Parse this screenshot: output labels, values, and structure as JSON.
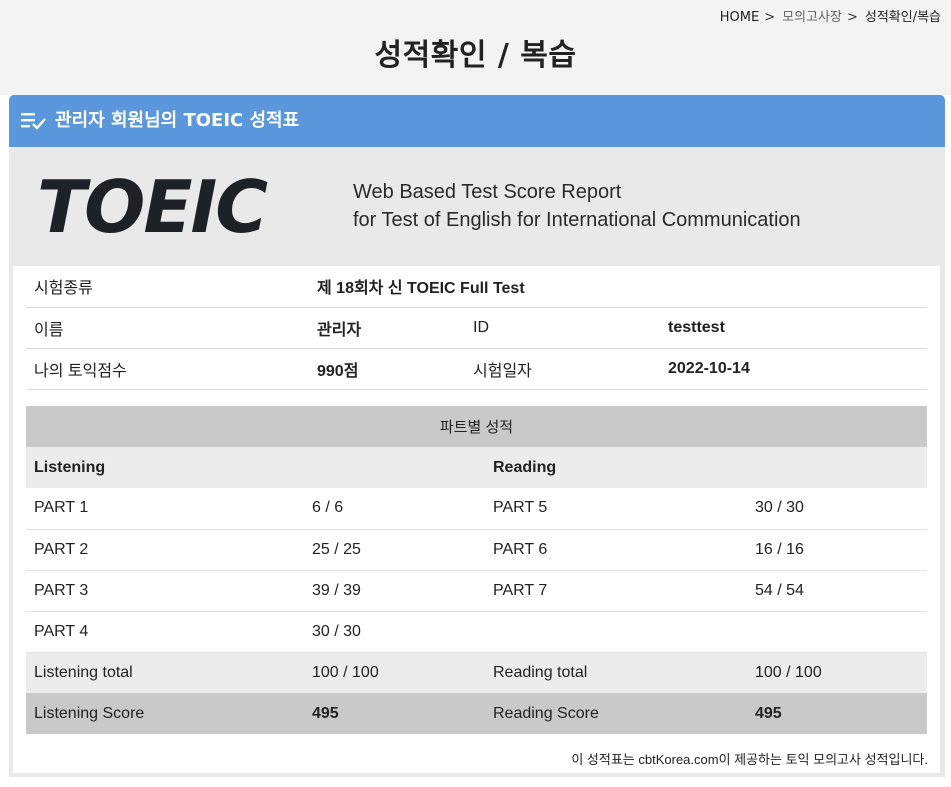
{
  "breadcrumb": {
    "home": "HOME",
    "section": "모의고사장",
    "current": "성적확인/복습",
    "separator": ">"
  },
  "page_title": "성적확인 / 복습",
  "panel": {
    "title": "관리자 회원님의 TOEIC 성적표",
    "icon": "list-check-icon",
    "header_color": "#5a97dd"
  },
  "report": {
    "logo_text": "TOEIC",
    "subtitle_line1": "Web Based Test Score Report",
    "subtitle_line2": "for Test of English for International Communication"
  },
  "info": {
    "exam_type_label": "시험종류",
    "exam_type_value": "제 18회차 신 TOEIC Full Test",
    "name_label": "이름",
    "name_value": "관리자",
    "id_label": "ID",
    "id_value": "testtest",
    "score_label": "나의 토익점수",
    "score_value": "990점",
    "date_label": "시험일자",
    "date_value": "2022-10-14"
  },
  "scores": {
    "heading": "파트별 성적",
    "listening_header": "Listening",
    "reading_header": "Reading",
    "rows": [
      {
        "l_part": "PART 1",
        "l_score": "6 / 6",
        "r_part": "PART 5",
        "r_score": "30 / 30"
      },
      {
        "l_part": "PART 2",
        "l_score": "25 / 25",
        "r_part": "PART 6",
        "r_score": "16 / 16"
      },
      {
        "l_part": "PART 3",
        "l_score": "39 / 39",
        "r_part": "PART 7",
        "r_score": "54 / 54"
      },
      {
        "l_part": "PART 4",
        "l_score": "30 / 30",
        "r_part": "",
        "r_score": ""
      }
    ],
    "listening_total_label": "Listening total",
    "listening_total_value": "100 / 100",
    "reading_total_label": "Reading total",
    "reading_total_value": "100 / 100",
    "listening_score_label": "Listening Score",
    "listening_score_value": "495",
    "reading_score_label": "Reading Score",
    "reading_score_value": "495"
  },
  "footnote": "이 성적표는 cbtKorea.com이 제공하는 토익 모의고사 성적입니다."
}
